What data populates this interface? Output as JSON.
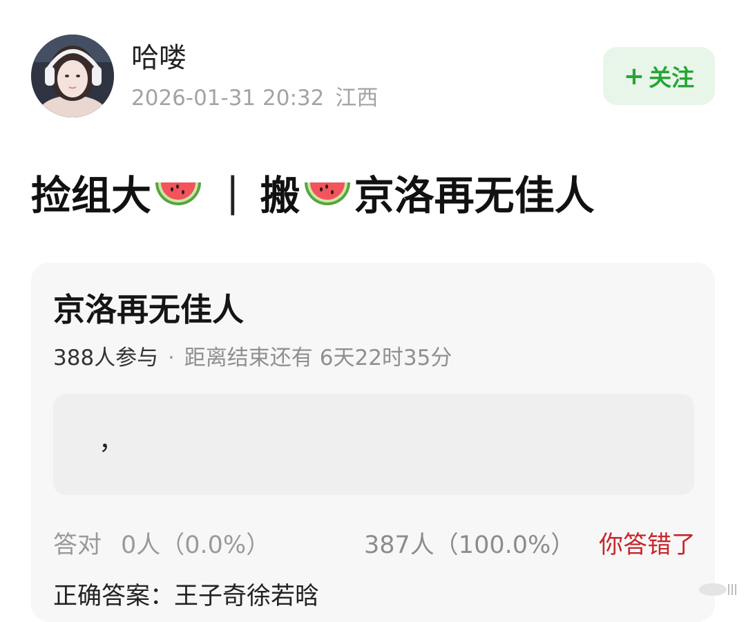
{
  "author": {
    "name": "哈喽",
    "datetime": "2026-01-31 20:32",
    "location": "江西",
    "avatar_icon": "avatar-photo"
  },
  "follow_button": {
    "plus": "+",
    "label": "关注"
  },
  "post": {
    "title_part1": "捡组大",
    "title_separator": "|",
    "title_part2": "搬",
    "title_part3": "京洛再无佳人",
    "emoji_icon": "watermelon-icon"
  },
  "quiz": {
    "title": "京洛再无佳人",
    "participants": "388人参与",
    "dot": "·",
    "remain_label": "距离结束还有",
    "remain_value": "6天22时35分",
    "answer_text": "，",
    "correct_label": "答对",
    "correct_count": "0人（0.0%）",
    "wrong_count": "387人（100.0%）",
    "wrong_status": "你答错了",
    "correct_answer_label": "正确答案：",
    "correct_answer_value": "王子奇徐若晗"
  },
  "colors": {
    "follow_bg": "#e8f6ea",
    "follow_text": "#27a535",
    "wrong_status": "#c8262b",
    "card_bg": "#f7f7f7"
  }
}
